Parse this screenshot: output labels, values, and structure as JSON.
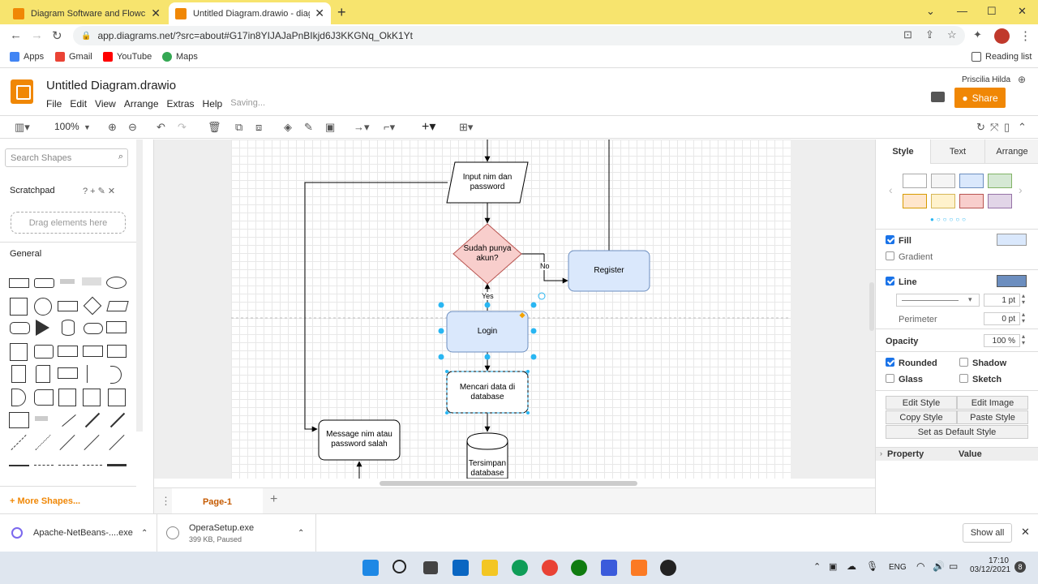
{
  "browser": {
    "tabs": [
      {
        "title": "Diagram Software and Flowchart",
        "active": false
      },
      {
        "title": "Untitled Diagram.drawio - diagra",
        "active": true
      }
    ],
    "url": "app.diagrams.net/?src=about#G17in8YIJAJaPnBIkjd6J3KKGNq_OkK1Yt",
    "bookmarks": [
      "Apps",
      "Gmail",
      "YouTube",
      "Maps"
    ],
    "reading_list": "Reading list"
  },
  "app": {
    "title": "Untitled Diagram.drawio",
    "menu": [
      "File",
      "Edit",
      "View",
      "Arrange",
      "Extras",
      "Help"
    ],
    "status": "Saving...",
    "user": "Priscilia Hilda",
    "share_label": "Share",
    "zoom": "100%"
  },
  "left_panel": {
    "search_placeholder": "Search Shapes",
    "scratchpad": "Scratchpad",
    "scratchpad_tools": "? + ✎ ✕",
    "drag_hint": "Drag elements here",
    "general": "General",
    "more_shapes": "More Shapes..."
  },
  "diagram": {
    "nodes": {
      "input": "Input nim dan password",
      "decision": "Sudah punya akun?",
      "register": "Register",
      "login": "Login",
      "search": "Mencari data di database",
      "message": "Message nim atau password salah",
      "store": "Tersimpan database"
    },
    "edge_labels": {
      "no": "No",
      "yes": "Yes"
    },
    "colors": {
      "decision_fill": "#f8cecc",
      "decision_stroke": "#b85450",
      "blue_fill": "#dae8fc",
      "blue_stroke": "#6c8ebf",
      "selection": "#29b6f2"
    }
  },
  "page_tab": "Page-1",
  "right_panel": {
    "tabs": [
      "Style",
      "Text",
      "Arrange"
    ],
    "swatches": [
      "#ffffff",
      "#f5f5f5",
      "#dae8fc",
      "#d5e8d4",
      "#ffe6cc",
      "#fff2cc",
      "#f8cecc",
      "#e1d5e7"
    ],
    "fill": "Fill",
    "gradient": "Gradient",
    "line": "Line",
    "line_width": "1 pt",
    "perimeter": "Perimeter",
    "perimeter_value": "0 pt",
    "opacity": "Opacity",
    "opacity_value": "100 %",
    "rounded": "Rounded",
    "shadow": "Shadow",
    "glass": "Glass",
    "sketch": "Sketch",
    "buttons": [
      "Edit Style",
      "Edit Image",
      "Copy Style",
      "Paste Style"
    ],
    "default_style": "Set as Default Style",
    "property": "Property",
    "value": "Value"
  },
  "downloads": [
    {
      "name": "Apache-NetBeans-....exe",
      "detail": ""
    },
    {
      "name": "OperaSetup.exe",
      "detail": "399 KB, Paused"
    }
  ],
  "show_all": "Show all",
  "taskbar": {
    "lang": "ENG",
    "time": "17:10",
    "date": "03/12/2021",
    "badge": "8"
  }
}
